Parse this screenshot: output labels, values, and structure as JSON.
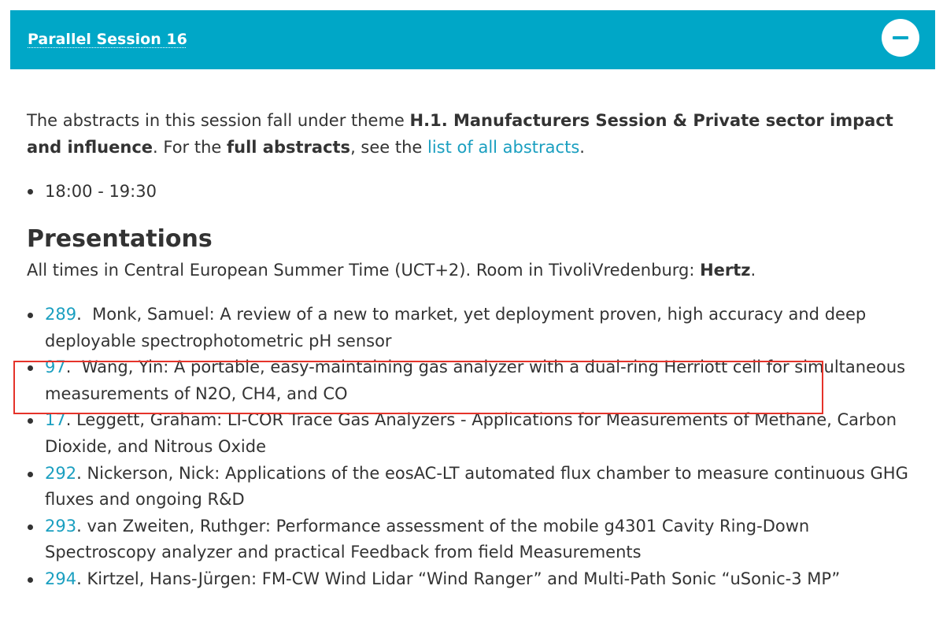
{
  "session": {
    "title": "Parallel Session 16",
    "collapse_icon": "minus-icon"
  },
  "intro": {
    "text1": "The abstracts in this session fall under theme ",
    "theme": "H.1. Manufacturers Session & Private sector impact and influence",
    "text2": ". For the ",
    "full_abstracts": "full abstracts",
    "text3": ", see the ",
    "link_label": "list of all abstracts",
    "text4": "."
  },
  "time": "18:00 - 19:30",
  "presentations": {
    "heading": "Presentations",
    "note_text": "All times in Central European Summer Time (UCT+2). Room in TivoliVredenburg: ",
    "room": "Hertz",
    "note_end": ".",
    "items": [
      {
        "id": "289",
        "sep": ".  ",
        "text": "Monk, Samuel: A review of a new to market, yet deployment proven, high accuracy and deep deployable spectrophotometric pH sensor"
      },
      {
        "id": "97",
        "sep": ".  ",
        "text": "Wang, Yin: A portable, easy-maintaining gas analyzer with a dual-ring Herriott cell for simultaneous measurements of N2O, CH4, and CO"
      },
      {
        "id": "17",
        "sep": ". ",
        "text": "Leggett, Graham: LI-COR Trace Gas Analyzers - Applications for Measurements of Methane, Carbon Dioxide, and Nitrous Oxide"
      },
      {
        "id": "292",
        "sep": ". ",
        "text": "Nickerson, Nick: Applications of the eosAC-LT automated flux chamber to measure continuous GHG fluxes and ongoing R&D"
      },
      {
        "id": "293",
        "sep": ". ",
        "text": "van Zweiten, Ruthger: Performance assessment of the mobile g4301 Cavity Ring-Down Spectroscopy analyzer and practical Feedback from field Measurements"
      },
      {
        "id": "294",
        "sep": ". ",
        "text": "Kirtzel, Hans-Jürgen: FM-CW Wind Lidar “Wind Ranger” and Multi-Path Sonic “uSonic-3 MP”"
      }
    ]
  },
  "colors": {
    "header_bg": "#00a7c7",
    "link": "#1a9fc0",
    "text": "#333333",
    "highlight": "#e5332a"
  }
}
